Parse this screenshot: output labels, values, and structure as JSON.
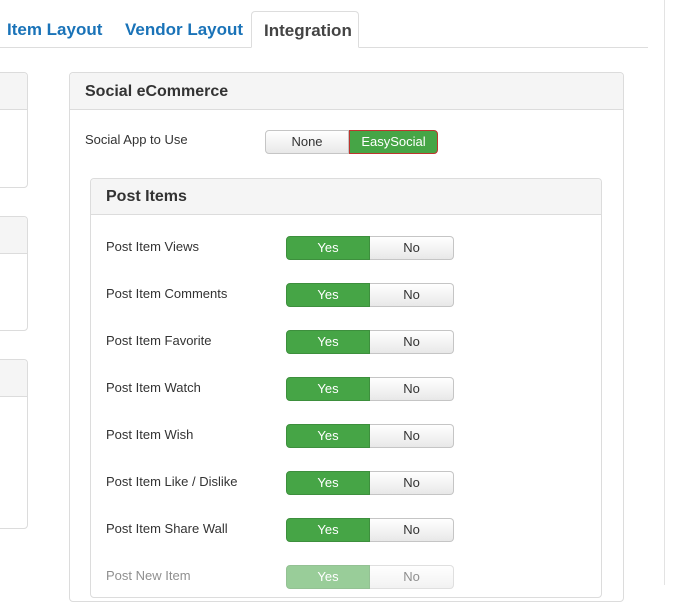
{
  "tabs": [
    {
      "label": "Item Layout"
    },
    {
      "label": "Vendor Layout"
    },
    {
      "label": "Integration"
    }
  ],
  "social": {
    "title": "Social eCommerce",
    "app_label": "Social App to Use",
    "options": [
      "None",
      "EasySocial"
    ],
    "selected": "EasySocial"
  },
  "post_items": {
    "title": "Post Items",
    "yes_label": "Yes",
    "no_label": "No",
    "rows": [
      {
        "label": "Post Item Views",
        "value": "Yes"
      },
      {
        "label": "Post Item Comments",
        "value": "Yes"
      },
      {
        "label": "Post Item Favorite",
        "value": "Yes"
      },
      {
        "label": "Post Item Watch",
        "value": "Yes"
      },
      {
        "label": "Post Item Wish",
        "value": "Yes"
      },
      {
        "label": "Post Item Like / Dislike",
        "value": "Yes"
      },
      {
        "label": "Post Item Share Wall",
        "value": "Yes"
      },
      {
        "label": "Post New Item",
        "value": "Yes"
      }
    ]
  },
  "colors": {
    "active_green": "#46a546",
    "tab_link": "#1a73b8",
    "selected_border": "#bd362f"
  }
}
